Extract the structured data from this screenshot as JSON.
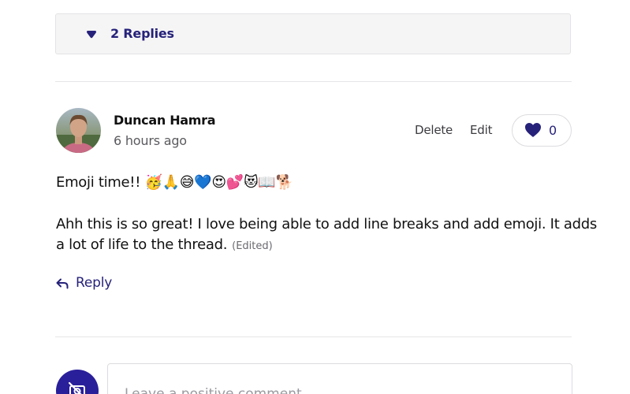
{
  "replies": {
    "label": "2 Replies",
    "caret_icon": "caret-down-icon"
  },
  "comment": {
    "author": "Duncan Hamra",
    "timestamp": "6 hours ago",
    "avatar_icon": "user-photo-avatar",
    "actions": {
      "delete_label": "Delete",
      "edit_label": "Edit"
    },
    "likes": {
      "icon": "heart-icon",
      "count": "0"
    },
    "body": {
      "line1": "Emoji time!! 🥳🙏😅💙😍💕😻📖🐕",
      "line2": "Ahh this is so great! I love being able to add line breaks and add emoji. It adds",
      "line3": "a lot of life to the thread.",
      "edited": "(Edited)"
    },
    "reply_label": "Reply",
    "reply_icon": "reply-arrow-icon"
  },
  "composer": {
    "placeholder": "Leave a positive comment...",
    "avatar_icon": "no-photo-icon"
  },
  "colors": {
    "accent": "#26227a",
    "composer_avatar": "#2a1f9a",
    "divider": "#e6e6e8",
    "replies_bg": "#f5f5f6"
  }
}
